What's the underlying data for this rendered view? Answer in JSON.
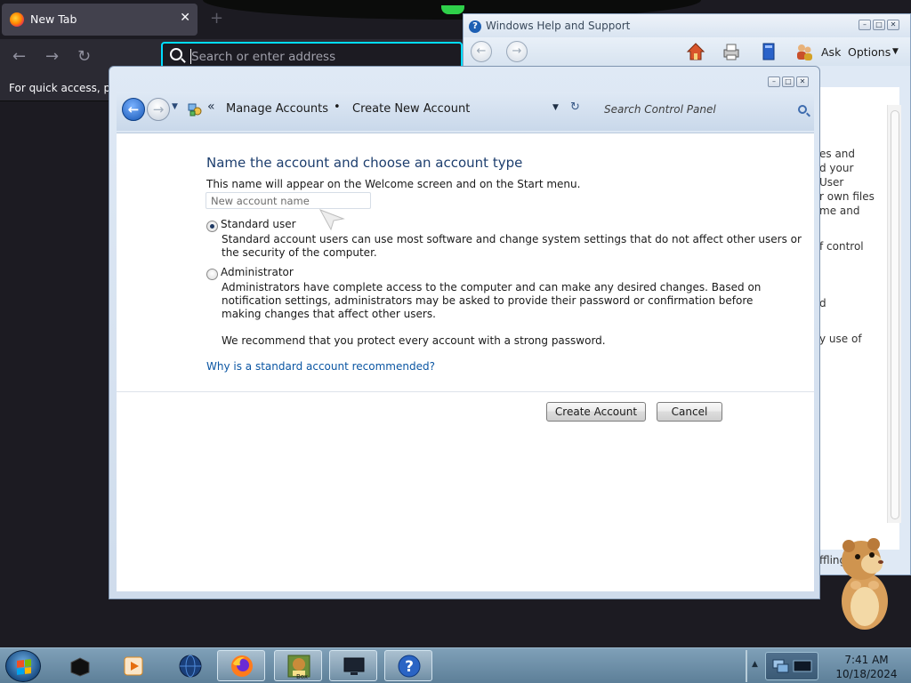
{
  "firefox": {
    "tab_title": "New Tab",
    "tab_close": "✕",
    "new_tab": "+",
    "url_placeholder": "Search or enter address",
    "bookmarks_text": "For quick access, plac"
  },
  "help_window": {
    "title": "Windows Help and Support",
    "ask_label": "Ask",
    "options_label": "Options",
    "content_fragments": [
      "es and",
      "d your",
      "User",
      "r own files",
      "me and",
      "f control",
      "d",
      "y use of",
      "ffling"
    ]
  },
  "dialog": {
    "breadcrumb": [
      "Manage Accounts",
      "Create New Account"
    ],
    "breadcrumb_prefix": "«",
    "breadcrumb_separator": "•",
    "search_placeholder": "Search Control Panel",
    "heading": "Name the account and choose an account type",
    "subtext": "This name will appear on the Welcome screen and on the Start menu.",
    "name_placeholder": "New account name",
    "standard_label": "Standard user",
    "standard_desc_1": "Standard account users can use most software and change system settings that do not affect other users or",
    "standard_desc_2": "the security of the computer.",
    "admin_label": "Administrator",
    "admin_desc_1": "Administrators have complete access to the computer and can make any desired changes. Based on",
    "admin_desc_2": "notification settings, administrators may be asked to provide their password or confirmation before",
    "admin_desc_3": "making changes that affect other users.",
    "recommend": "We recommend that you protect every account with a strong password.",
    "why_link": "Why is a standard account recommended?",
    "create_button": "Create Account",
    "cancel_button": "Cancel",
    "selected_account_type": "Standard user"
  },
  "taskbar": {
    "time": "7:41 AM",
    "date": "10/18/2024",
    "tray_arrow": "▲",
    "box_label": "Box"
  },
  "colors": {
    "heading_blue": "#1d3e6e",
    "link_blue": "#0b56a3",
    "firefox_focus": "#00ddff",
    "taskbar": "#6a8ca5"
  }
}
